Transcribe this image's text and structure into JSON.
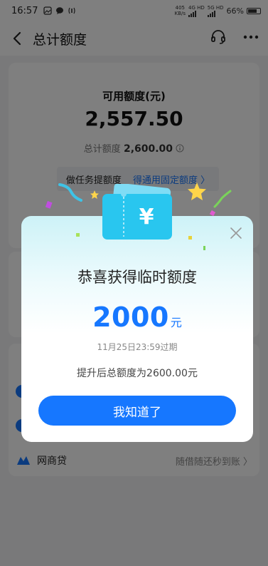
{
  "status_bar": {
    "time": "16:57",
    "net_speed_top": "405",
    "net_speed_bottom": "KB/s",
    "sim1_label": "4G HD",
    "sim2_label": "5G HD",
    "battery": "66%"
  },
  "nav": {
    "title": "总计额度",
    "back_icon": "chevron-left-icon",
    "support_icon": "headset-icon",
    "more_icon": "more-dots-icon"
  },
  "summary": {
    "available_label": "可用额度(元)",
    "available_value": "2,557.50",
    "total_label": "总计额度",
    "total_value": "2,600.00",
    "task_text": "做任务提额度",
    "task_link": "得通用固定额度 〉"
  },
  "products": {
    "wangshangdai_name": "网商贷",
    "wangshangdai_slogan": "随借随还秒到账 〉"
  },
  "modal": {
    "title": "恭喜获得临时额度",
    "amount": "2000",
    "unit": "元",
    "expire": "11月25日23:59过期",
    "after_text": "提升后总额度为2600.00元",
    "confirm_button": "我知道了",
    "ticket_symbol": "¥"
  },
  "colors": {
    "accent": "#1677ff",
    "ticket": "#29c6ef"
  }
}
